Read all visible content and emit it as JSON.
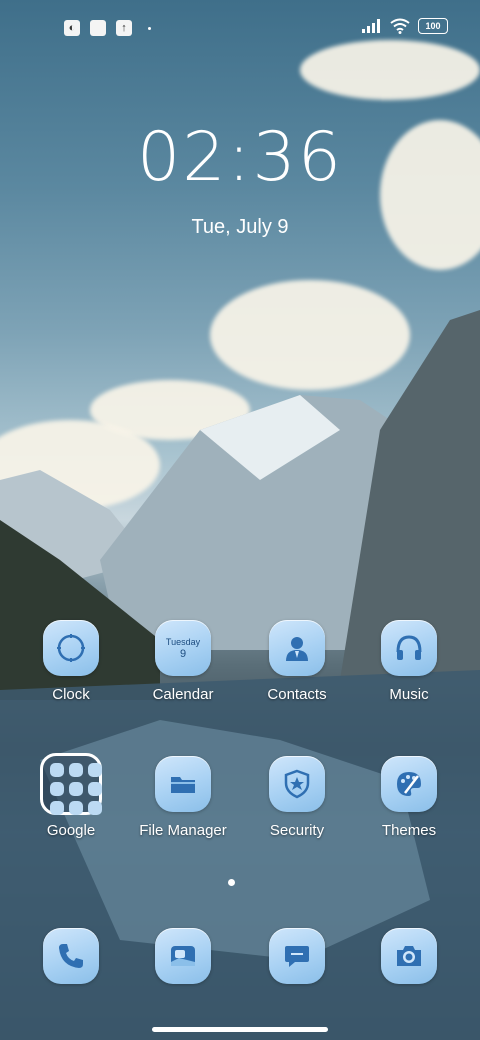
{
  "status_bar": {
    "left_icons": [
      "notification-app-icon",
      "notification-square-icon",
      "upload-icon"
    ],
    "right_icons": [
      "signal-icon",
      "wifi-icon"
    ],
    "battery_level": "100"
  },
  "lock": {
    "time": "02:36",
    "date": "Tue, July 9"
  },
  "apps_row1": [
    {
      "label": "Clock",
      "icon": "clock-icon"
    },
    {
      "label": "Calendar",
      "icon": "calendar-icon",
      "cal_day": "Tuesday",
      "cal_date": "9"
    },
    {
      "label": "Contacts",
      "icon": "contacts-icon"
    },
    {
      "label": "Music",
      "icon": "headphones-icon"
    }
  ],
  "apps_row2": [
    {
      "label": "Google",
      "icon": "google-folder-icon"
    },
    {
      "label": "File Manager",
      "icon": "folder-icon"
    },
    {
      "label": "Security",
      "icon": "shield-star-icon"
    },
    {
      "label": "Themes",
      "icon": "palette-icon"
    }
  ],
  "dock": [
    {
      "icon": "phone-icon"
    },
    {
      "icon": "gallery-icon"
    },
    {
      "icon": "messages-icon"
    },
    {
      "icon": "camera-icon"
    }
  ],
  "accent_color": "#2f6fb2"
}
